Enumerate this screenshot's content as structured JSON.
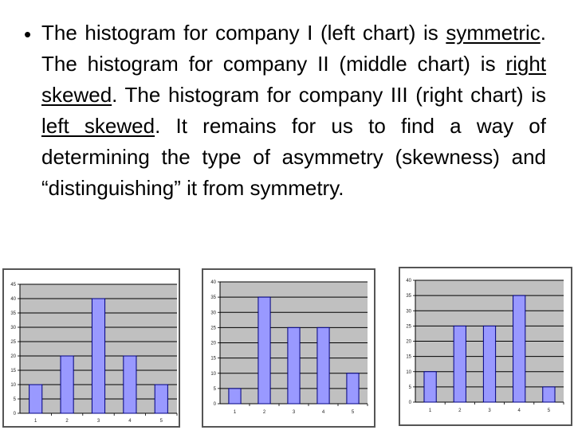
{
  "text": {
    "bullet": "•",
    "segments": [
      {
        "t": "The histogram for company I (left chart) is ",
        "u": false
      },
      {
        "t": "symmetric",
        "u": true
      },
      {
        "t": ". The histogram for company II (middle chart) is ",
        "u": false
      },
      {
        "t": "right skewed",
        "u": true
      },
      {
        "t": ". The histogram for company III (right chart) is ",
        "u": false
      },
      {
        "t": "left skewed",
        "u": true
      },
      {
        "t": ". It remains for us to find a way of determining the type of asymmetry (skewness) and “distinguishing” it from symmetry.",
        "u": false
      }
    ]
  },
  "colors": {
    "bar": "#9999ff",
    "plot_bg": "#c0c0c0",
    "bar_edge": "#000080"
  },
  "chart_data": [
    {
      "type": "bar",
      "categories": [
        "1",
        "2",
        "3",
        "4",
        "5"
      ],
      "values": [
        10,
        20,
        40,
        20,
        10
      ],
      "ylim": [
        0,
        45
      ],
      "yticks": [
        0,
        5,
        10,
        15,
        20,
        25,
        30,
        35,
        40,
        45
      ],
      "grid": true,
      "legend": "none"
    },
    {
      "type": "bar",
      "categories": [
        "1",
        "2",
        "3",
        "4",
        "5"
      ],
      "values": [
        5,
        35,
        25,
        25,
        10
      ],
      "ylim": [
        0,
        40
      ],
      "yticks": [
        0,
        5,
        10,
        15,
        20,
        25,
        30,
        35,
        40
      ],
      "grid": true,
      "legend": "none"
    },
    {
      "type": "bar",
      "categories": [
        "1",
        "2",
        "3",
        "4",
        "5"
      ],
      "values": [
        10,
        25,
        25,
        35,
        5
      ],
      "ylim": [
        0,
        40
      ],
      "yticks": [
        0,
        5,
        10,
        15,
        20,
        25,
        30,
        35,
        40
      ],
      "grid": true,
      "legend": "none"
    }
  ]
}
